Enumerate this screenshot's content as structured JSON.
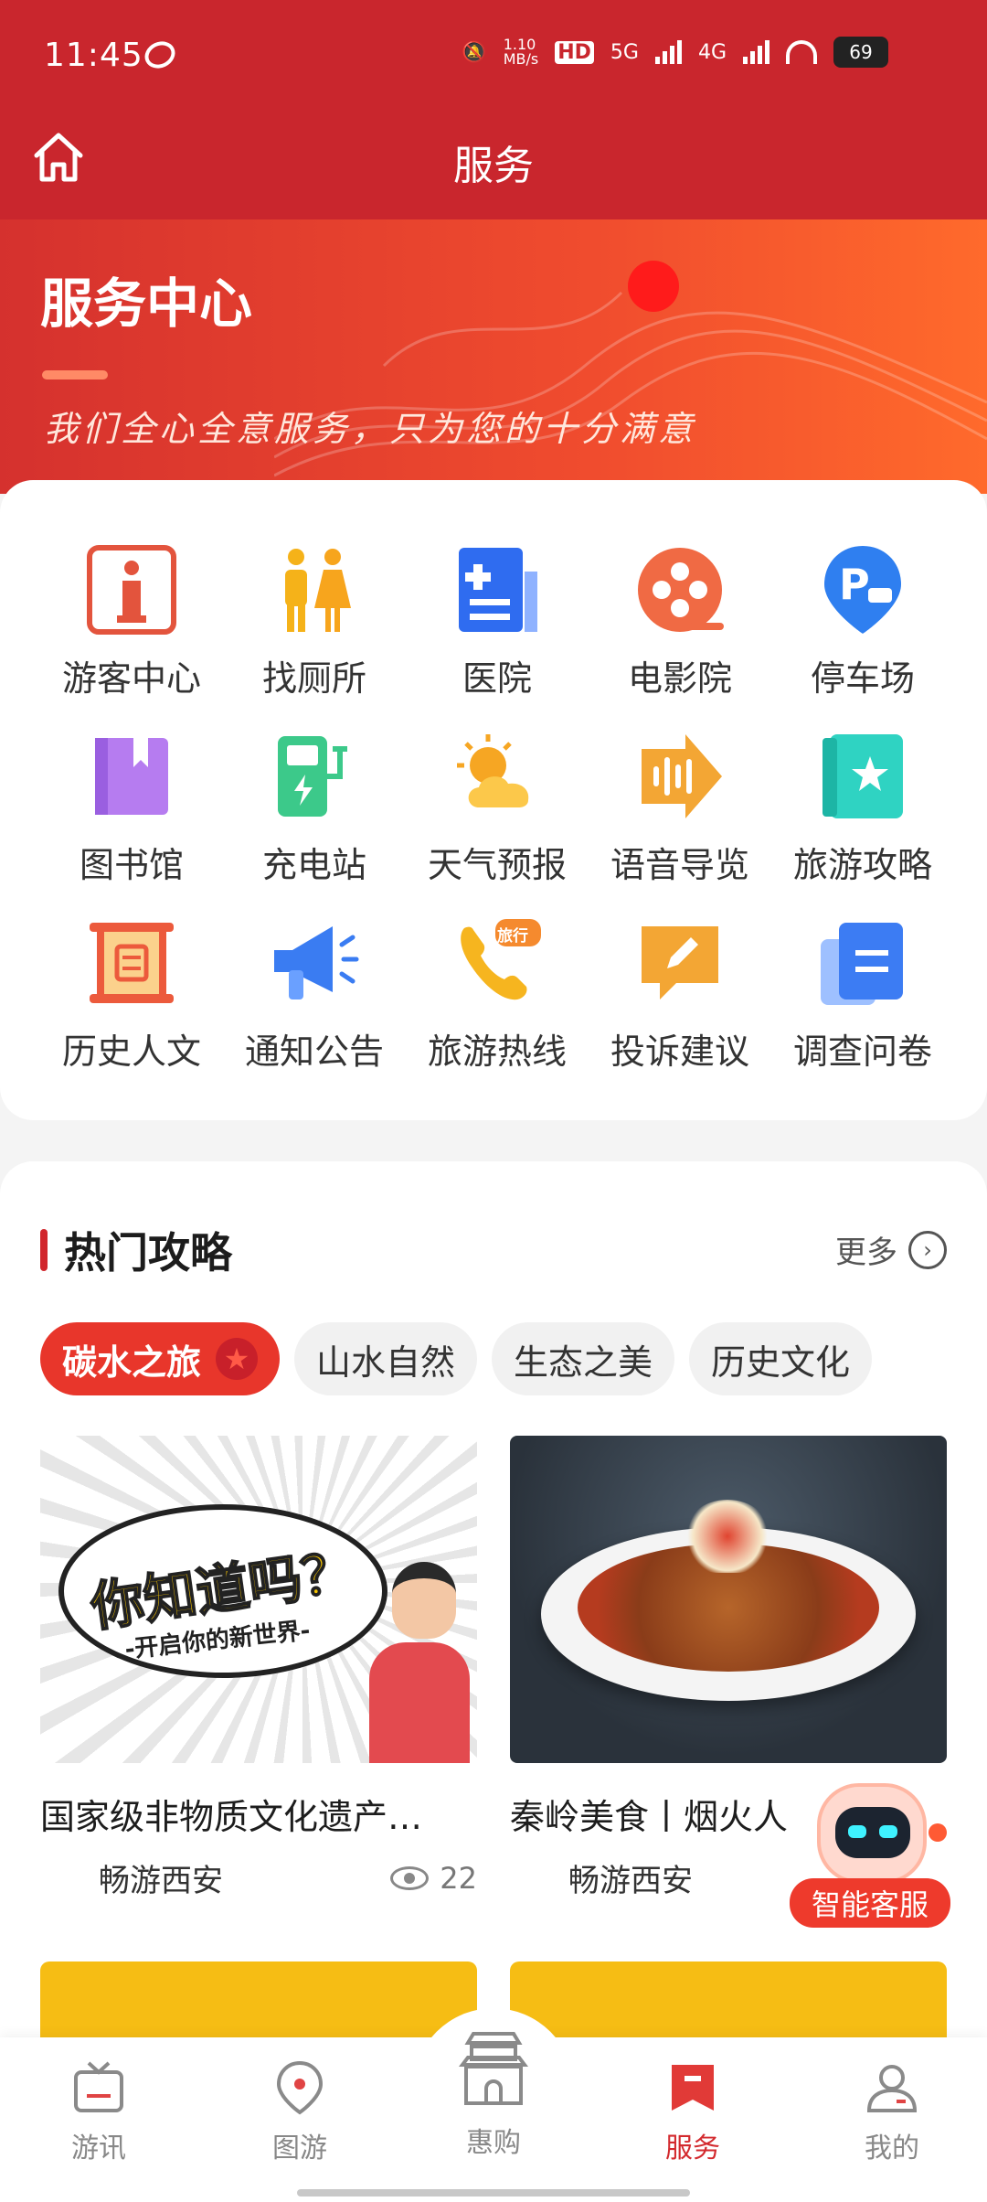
{
  "status_bar": {
    "time": "11:45",
    "net_speed": "1.10\nMB/s",
    "net_labels": [
      "HD",
      "5G",
      "4G"
    ],
    "battery": "69"
  },
  "header": {
    "title": "服务"
  },
  "banner": {
    "title": "服务中心",
    "slogan": "我们全心全意服务，只为您的十分满意"
  },
  "services": [
    {
      "label": "游客中心",
      "icon": "info-icon"
    },
    {
      "label": "找厕所",
      "icon": "restroom-icon"
    },
    {
      "label": "医院",
      "icon": "hospital-icon"
    },
    {
      "label": "电影院",
      "icon": "cinema-icon"
    },
    {
      "label": "停车场",
      "icon": "parking-icon"
    },
    {
      "label": "图书馆",
      "icon": "library-icon"
    },
    {
      "label": "充电站",
      "icon": "charging-icon"
    },
    {
      "label": "天气预报",
      "icon": "weather-icon"
    },
    {
      "label": "语音导览",
      "icon": "voice-guide-icon"
    },
    {
      "label": "旅游攻略",
      "icon": "travel-guide-icon"
    },
    {
      "label": "历史人文",
      "icon": "scroll-icon"
    },
    {
      "label": "通知公告",
      "icon": "megaphone-icon"
    },
    {
      "label": "旅游热线",
      "icon": "phone-icon"
    },
    {
      "label": "投诉建议",
      "icon": "complaint-icon"
    },
    {
      "label": "调查问卷",
      "icon": "survey-icon"
    }
  ],
  "phone_badge": "旅行",
  "hot": {
    "title": "热门攻略",
    "more": "更多",
    "tabs": [
      "碳水之旅",
      "山水自然",
      "生态之美",
      "历史文化"
    ],
    "cards": [
      {
        "title": "国家级非物质文化遗产…",
        "author": "畅游西安",
        "views": "22",
        "image_big": "你知道吗？",
        "image_small": "-开启你的新世界-"
      },
      {
        "title": "秦岭美食丨烟火人",
        "author": "畅游西安"
      }
    ]
  },
  "assistant": {
    "label": "智能客服"
  },
  "nav": [
    {
      "label": "游讯",
      "icon": "news-icon"
    },
    {
      "label": "图游",
      "icon": "map-pin-icon"
    },
    {
      "label": "惠购",
      "icon": "tower-icon"
    },
    {
      "label": "服务",
      "icon": "service-icon",
      "active": true
    },
    {
      "label": "我的",
      "icon": "profile-icon"
    }
  ],
  "colors": {
    "primary": "#c9262d",
    "accent": "#e8362b",
    "yellow": "#f6bd14"
  }
}
